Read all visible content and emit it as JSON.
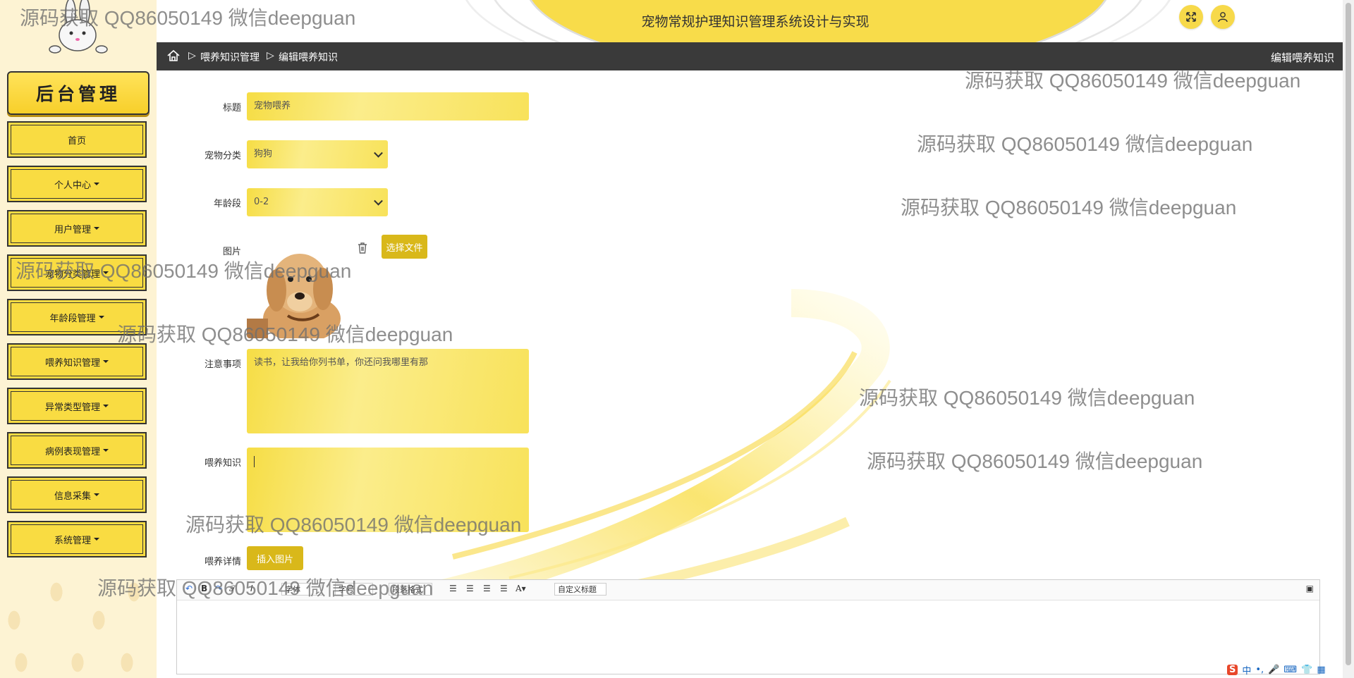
{
  "header": {
    "title": "宠物常规护理知识管理系统设计与实现",
    "fullscreen_icon": "expand-icon",
    "user_icon": "user-icon"
  },
  "sidebar": {
    "sign": "后台管理",
    "items": [
      {
        "label": "首页",
        "dropdown": false
      },
      {
        "label": "个人中心",
        "dropdown": true
      },
      {
        "label": "用户管理",
        "dropdown": true
      },
      {
        "label": "宠物分类管理",
        "dropdown": true
      },
      {
        "label": "年龄段管理",
        "dropdown": true
      },
      {
        "label": "喂养知识管理",
        "dropdown": true
      },
      {
        "label": "异常类型管理",
        "dropdown": true
      },
      {
        "label": "病例表现管理",
        "dropdown": true
      },
      {
        "label": "信息采集",
        "dropdown": true
      },
      {
        "label": "系统管理",
        "dropdown": true
      }
    ]
  },
  "breadcrumb": {
    "items": [
      "喂养知识管理",
      "编辑喂养知识"
    ],
    "separator": "▷",
    "page_title": "编辑喂养知识"
  },
  "form": {
    "title_label": "标题",
    "title_value": "宠物喂养",
    "category_label": "宠物分类",
    "category_value": "狗狗",
    "age_label": "年龄段",
    "age_value": "0-2",
    "image_label": "图片",
    "choose_file": "选择文件",
    "notes_label": "注意事项",
    "notes_value": "读书，让我给你列书单，你还问我哪里有那",
    "knowledge_label": "喂养知识",
    "knowledge_value": "",
    "detail_label": "喂养详情",
    "insert_image": "插入图片"
  },
  "editor": {
    "font_family": "字体",
    "font_size": "字号",
    "paragraph": "段落格式",
    "custom_title": "自定义标题"
  },
  "watermark": "源码获取 QQ86050149 微信deepguan",
  "tray": {
    "ime": "中"
  },
  "colors": {
    "accent": "#f9dc42",
    "dark_bar": "#3a3a3a",
    "button": "#d9b81a"
  }
}
